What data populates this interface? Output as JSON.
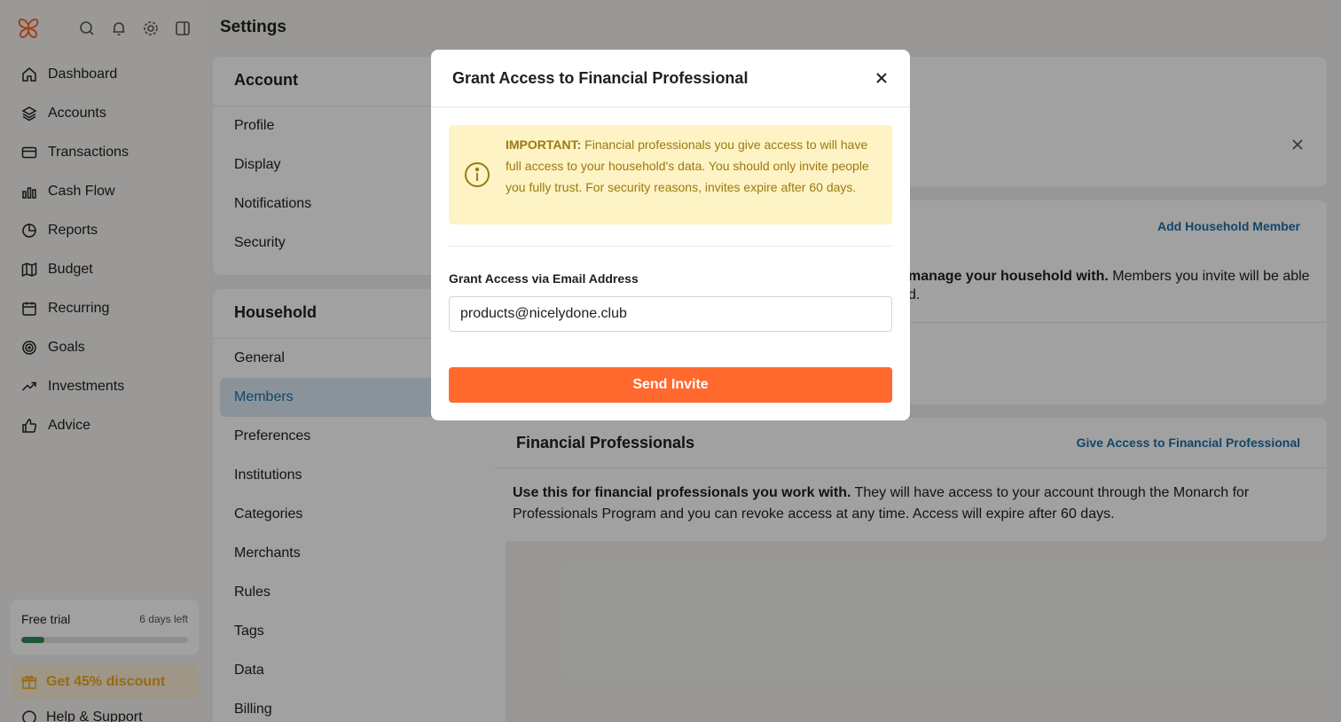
{
  "header": {
    "title": "Settings"
  },
  "sidebar": {
    "nav": [
      {
        "label": "Dashboard",
        "icon": "home-icon"
      },
      {
        "label": "Accounts",
        "icon": "layers-icon"
      },
      {
        "label": "Transactions",
        "icon": "credit-card-icon"
      },
      {
        "label": "Cash Flow",
        "icon": "bar-chart-icon"
      },
      {
        "label": "Reports",
        "icon": "pie-chart-icon"
      },
      {
        "label": "Budget",
        "icon": "map-icon"
      },
      {
        "label": "Recurring",
        "icon": "calendar-icon"
      },
      {
        "label": "Goals",
        "icon": "target-icon"
      },
      {
        "label": "Investments",
        "icon": "trending-up-icon"
      },
      {
        "label": "Advice",
        "icon": "thumbs-up-icon"
      }
    ],
    "trial": {
      "title": "Free trial",
      "days_left": "6 days left",
      "progress": 0.14
    },
    "discount": "Get 45% discount",
    "help": "Help & Support"
  },
  "settings_menu": {
    "account": {
      "title": "Account",
      "items": [
        "Profile",
        "Display",
        "Notifications",
        "Security"
      ]
    },
    "household": {
      "title": "Household",
      "items": [
        "General",
        "Members",
        "Preferences",
        "Institutions",
        "Categories",
        "Merchants",
        "Rules",
        "Tags",
        "Data",
        "Billing"
      ],
      "active": "Members"
    }
  },
  "content": {
    "members_card": {
      "link": "Add Household Member",
      "text_bold": "manage your household with.",
      "text_rest": " Members you invite will be able",
      "text_line2": "d."
    },
    "pros_card": {
      "title": "Financial Professionals",
      "link": "Give Access to Financial Professional",
      "text_bold": "Use this for financial professionals you work with.",
      "text_rest": " They will have access to your account through the Monarch for Professionals Program and you can revoke access at any time. Access will expire after 60 days."
    }
  },
  "modal": {
    "title": "Grant Access to Financial Professional",
    "notice_bold": "IMPORTANT:",
    "notice_text": " Financial professionals you give access to will have full access to your household's data. You should only invite people you fully trust. For security reasons, invites expire after 60 days.",
    "field_label": "Grant Access via Email Address",
    "email_value": "products@nicelydone.club",
    "send_label": "Send Invite"
  },
  "colors": {
    "accent": "#ff692d",
    "link": "#1f6fa5",
    "notice_bg": "#fdf3c4",
    "notice_text": "#9c7a12",
    "trial_progress": "#2e8b57",
    "discount_text": "#f0a81f"
  }
}
